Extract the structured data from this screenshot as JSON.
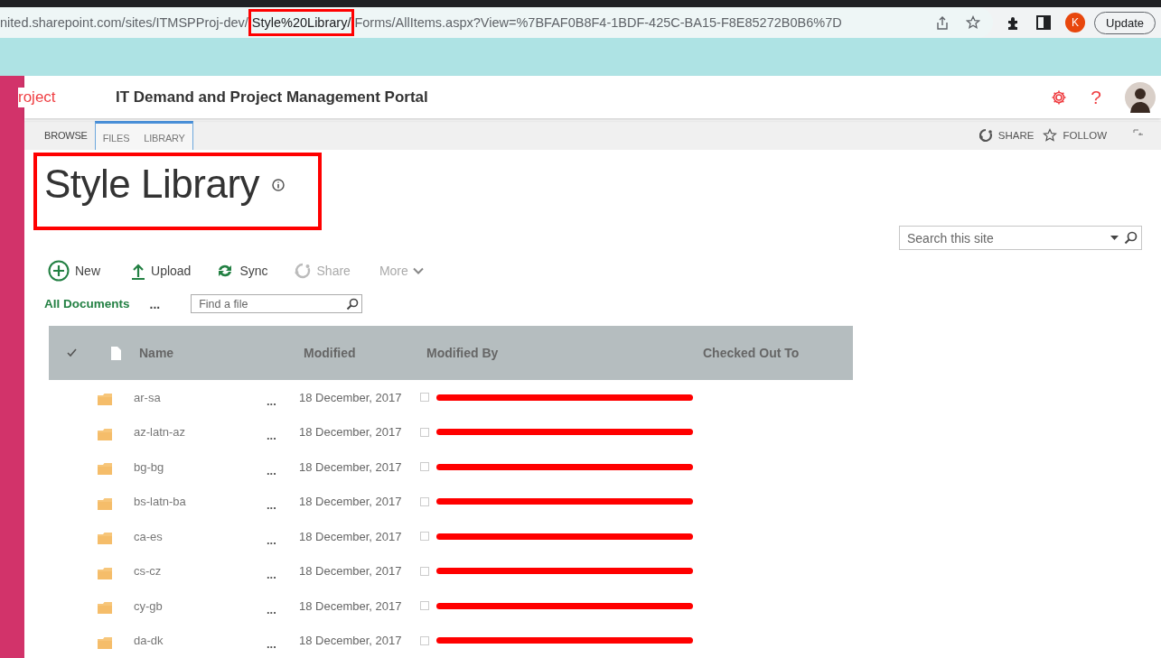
{
  "browser": {
    "url_parts": [
      {
        "text": "nited.sharepoint.com/sites/ITMSPProj-dev/",
        "highlighted": false
      },
      {
        "text": "Style%20Library/",
        "highlighted": true
      },
      {
        "text": "Forms/AllItems.aspx?View=%7BFAF0B8F4-1BDF-425C-BA15-F8E85272B0B6%7D",
        "highlighted": false
      }
    ],
    "profile_letter": "K",
    "update_button": "Update"
  },
  "header": {
    "site_logo_text": "roject",
    "portal_title": "IT Demand and Project Management Portal",
    "help_glyph": "?"
  },
  "ribbon": {
    "tabs": [
      {
        "label": "BROWSE",
        "selected": true,
        "contextual": false
      },
      {
        "label": "FILES",
        "selected": false,
        "contextual": true
      },
      {
        "label": "LIBRARY",
        "selected": false,
        "contextual": true
      }
    ],
    "actions": [
      "SHARE",
      "FOLLOW"
    ]
  },
  "page_title": {
    "text": "Style Library",
    "highlighted": true
  },
  "commands": [
    {
      "label": "New",
      "disabled": false
    },
    {
      "label": "Upload",
      "disabled": false
    },
    {
      "label": "Sync",
      "disabled": false
    },
    {
      "label": "Share",
      "disabled": true
    },
    {
      "label": "More",
      "disabled": true
    }
  ],
  "view": {
    "current": "All Documents",
    "more": "...",
    "find_placeholder": "Find a file"
  },
  "search": {
    "placeholder": "Search this site"
  },
  "table": {
    "columns": [
      "Name",
      "Modified",
      "Modified By",
      "Checked Out To"
    ],
    "rows": [
      {
        "name": "ar-sa",
        "menu": "...",
        "modified": "18 December, 2017",
        "checked": false,
        "modified_by_redacted": true
      },
      {
        "name": "az-latn-az",
        "menu": "...",
        "modified": "18 December, 2017",
        "checked": false,
        "modified_by_redacted": true
      },
      {
        "name": "bg-bg",
        "menu": "...",
        "modified": "18 December, 2017",
        "checked": false,
        "modified_by_redacted": true
      },
      {
        "name": "bs-latn-ba",
        "menu": "...",
        "modified": "18 December, 2017",
        "checked": false,
        "modified_by_redacted": true
      },
      {
        "name": "ca-es",
        "menu": "...",
        "modified": "18 December, 2017",
        "checked": false,
        "modified_by_redacted": true
      },
      {
        "name": "cs-cz",
        "menu": "...",
        "modified": "18 December, 2017",
        "checked": false,
        "modified_by_redacted": true
      },
      {
        "name": "cy-gb",
        "menu": "...",
        "modified": "18 December, 2017",
        "checked": false,
        "modified_by_redacted": true
      },
      {
        "name": "da-dk",
        "menu": "...",
        "modified": "18 December, 2017",
        "checked": false,
        "modified_by_redacted": true
      }
    ]
  }
}
